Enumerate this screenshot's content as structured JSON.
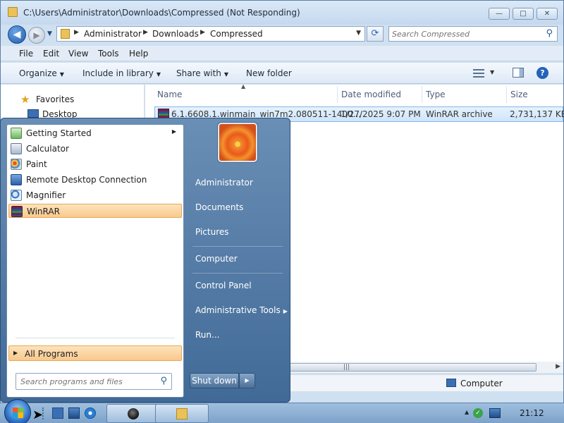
{
  "window": {
    "title": "C:\\Users\\Administrator\\Downloads\\Compressed (Not Responding)",
    "controls": {
      "minimize": "—",
      "maximize": "□",
      "close": "✕"
    }
  },
  "nav": {
    "back_glyph": "◀",
    "forward_glyph": "▶",
    "recent_glyph": "▼",
    "breadcrumbs": [
      "Administrator",
      "Downloads",
      "Compressed"
    ],
    "refresh_glyph": "⟳",
    "search_placeholder": "Search Compressed"
  },
  "menu": [
    "File",
    "Edit",
    "View",
    "Tools",
    "Help"
  ],
  "commands": {
    "organize": "Organize",
    "include_in_library": "Include in library",
    "share_with": "Share with",
    "new_folder": "New folder",
    "help": "?"
  },
  "navpane": {
    "favorites": "Favorites",
    "desktop": "Desktop"
  },
  "columns": {
    "name": "Name",
    "date_modified": "Date modified",
    "type": "Type",
    "size": "Size"
  },
  "files": [
    {
      "name": "6.1.6608.1.winmain_win7m2.080511-1400...",
      "date": "1/27/2025 9:07 PM",
      "type": "WinRAR archive",
      "size": "2,731,137 KB"
    }
  ],
  "status": {
    "location": "Computer"
  },
  "start_menu": {
    "programs": [
      {
        "label": "Getting Started",
        "icon": "getting-started-icon",
        "has_submenu": true
      },
      {
        "label": "Calculator",
        "icon": "calculator-icon"
      },
      {
        "label": "Paint",
        "icon": "paint-icon"
      },
      {
        "label": "Remote Desktop Connection",
        "icon": "remote-desktop-icon"
      },
      {
        "label": "Magnifier",
        "icon": "magnifier-icon"
      },
      {
        "label": "WinRAR",
        "icon": "winrar-icon",
        "selected": true
      }
    ],
    "all_programs": "All Programs",
    "search_placeholder": "Search programs and files",
    "right_links": [
      "Administrator",
      "Documents",
      "Pictures",
      "Computer",
      "Control Panel",
      "Administrative Tools",
      "Run..."
    ],
    "shutdown": "Shut down"
  },
  "taskbar": {
    "clock": "21:12"
  },
  "colors": {
    "accent": "#2463b9",
    "selection": "#f9c98c",
    "start_menu": "#416a97"
  }
}
